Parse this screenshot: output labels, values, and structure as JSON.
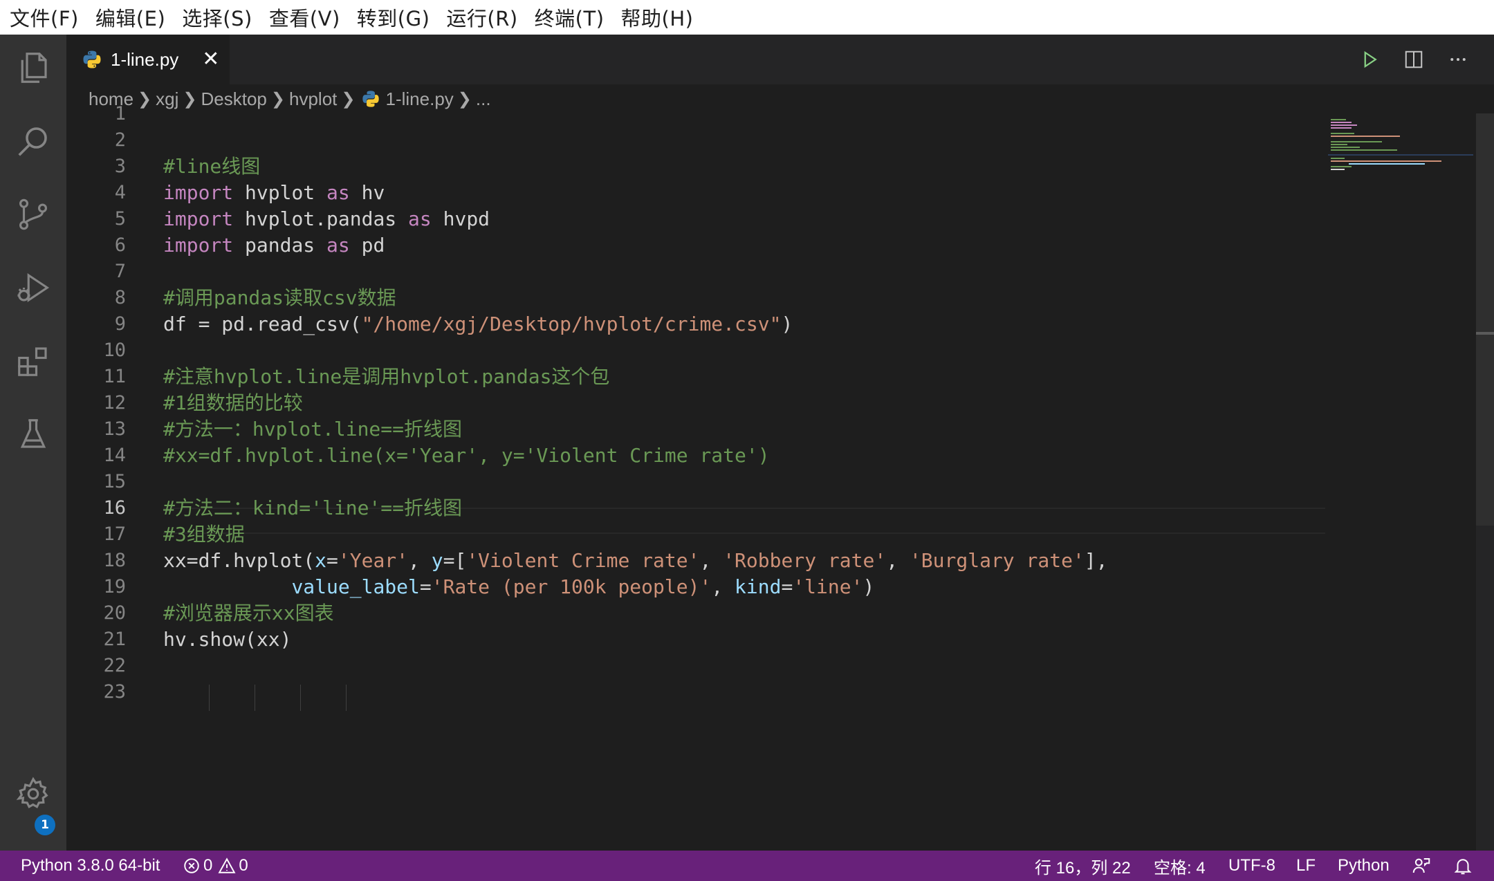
{
  "menu": [
    "文件(F)",
    "编辑(E)",
    "选择(S)",
    "查看(V)",
    "转到(G)",
    "运行(R)",
    "终端(T)",
    "帮助(H)"
  ],
  "activity": {
    "icons": [
      "files-icon",
      "search-icon",
      "source-control-icon",
      "run-debug-icon",
      "extensions-icon",
      "testing-icon"
    ],
    "settings_badge": "1"
  },
  "tab": {
    "label": "1-line.py",
    "close": "✕"
  },
  "breadcrumb": [
    "home",
    "xgj",
    "Desktop",
    "hvplot",
    "1-line.py",
    "..."
  ],
  "editor": {
    "line_numbers": [
      "1",
      "2",
      "3",
      "4",
      "5",
      "6",
      "7",
      "8",
      "9",
      "10",
      "11",
      "12",
      "13",
      "14",
      "15",
      "16",
      "17",
      "18",
      "19",
      "20",
      "21",
      "22",
      "23"
    ],
    "active_line": 16,
    "lines": [
      [],
      [],
      [
        {
          "t": "#line线图",
          "c": "com"
        }
      ],
      [
        {
          "t": "import",
          "c": "kw"
        },
        {
          "t": " hvplot ",
          "c": "txt"
        },
        {
          "t": "as",
          "c": "kw"
        },
        {
          "t": " hv",
          "c": "txt"
        }
      ],
      [
        {
          "t": "import",
          "c": "kw"
        },
        {
          "t": " hvplot.pandas ",
          "c": "txt"
        },
        {
          "t": "as",
          "c": "kw"
        },
        {
          "t": " hvpd",
          "c": "txt"
        }
      ],
      [
        {
          "t": "import",
          "c": "kw"
        },
        {
          "t": " pandas ",
          "c": "txt"
        },
        {
          "t": "as",
          "c": "kw"
        },
        {
          "t": " pd",
          "c": "txt"
        }
      ],
      [],
      [
        {
          "t": "#调用pandas读取csv数据",
          "c": "com"
        }
      ],
      [
        {
          "t": "df = pd.read_csv(",
          "c": "txt"
        },
        {
          "t": "\"/home/xgj/Desktop/hvplot/crime.csv\"",
          "c": "str"
        },
        {
          "t": ")",
          "c": "txt"
        }
      ],
      [],
      [
        {
          "t": "#注意hvplot.line是调用hvplot.pandas这个包",
          "c": "com"
        }
      ],
      [
        {
          "t": "#1组数据的比较",
          "c": "com"
        }
      ],
      [
        {
          "t": "#方法一：hvplot.line==折线图",
          "c": "com"
        }
      ],
      [
        {
          "t": "#xx=df.hvplot.line(x='Year', y='Violent Crime rate')",
          "c": "com"
        }
      ],
      [],
      [
        {
          "t": "#方法二：kind='line'==折线图",
          "c": "com"
        }
      ],
      [
        {
          "t": "#3组数据",
          "c": "com"
        }
      ],
      [
        {
          "t": "xx=df.hvplot(",
          "c": "txt"
        },
        {
          "t": "x",
          "c": "par"
        },
        {
          "t": "=",
          "c": "txt"
        },
        {
          "t": "'Year'",
          "c": "str"
        },
        {
          "t": ", ",
          "c": "txt"
        },
        {
          "t": "y",
          "c": "par"
        },
        {
          "t": "=[",
          "c": "txt"
        },
        {
          "t": "'Violent Crime rate'",
          "c": "str"
        },
        {
          "t": ", ",
          "c": "txt"
        },
        {
          "t": "'Robbery rate'",
          "c": "str"
        },
        {
          "t": ", ",
          "c": "txt"
        },
        {
          "t": "'Burglary rate'",
          "c": "str"
        },
        {
          "t": "],",
          "c": "txt"
        }
      ],
      [
        {
          "t": "           ",
          "c": "txt"
        },
        {
          "t": "value_label",
          "c": "par"
        },
        {
          "t": "=",
          "c": "txt"
        },
        {
          "t": "'Rate (per 100k people)'",
          "c": "str"
        },
        {
          "t": ", ",
          "c": "txt"
        },
        {
          "t": "kind",
          "c": "par"
        },
        {
          "t": "=",
          "c": "txt"
        },
        {
          "t": "'line'",
          "c": "str"
        },
        {
          "t": ")",
          "c": "txt"
        }
      ],
      [
        {
          "t": "#浏览器展示xx图表",
          "c": "com"
        }
      ],
      [
        {
          "t": "hv.show(xx)",
          "c": "txt"
        }
      ],
      [],
      []
    ]
  },
  "statusbar": {
    "interpreter": "Python 3.8.0 64-bit",
    "errors": "0",
    "warnings": "0",
    "position": "行 16，列 22",
    "indent": "空格: 4",
    "encoding": "UTF-8",
    "eol": "LF",
    "language": "Python"
  },
  "colors": {
    "statusbar": "#68217a",
    "activitybar": "#333333",
    "editor_bg": "#1e1e1e",
    "comment": "#6a9955",
    "keyword": "#c586c0",
    "string": "#ce9178",
    "parameter": "#9cdcfe",
    "badge": "#0e70c0"
  }
}
